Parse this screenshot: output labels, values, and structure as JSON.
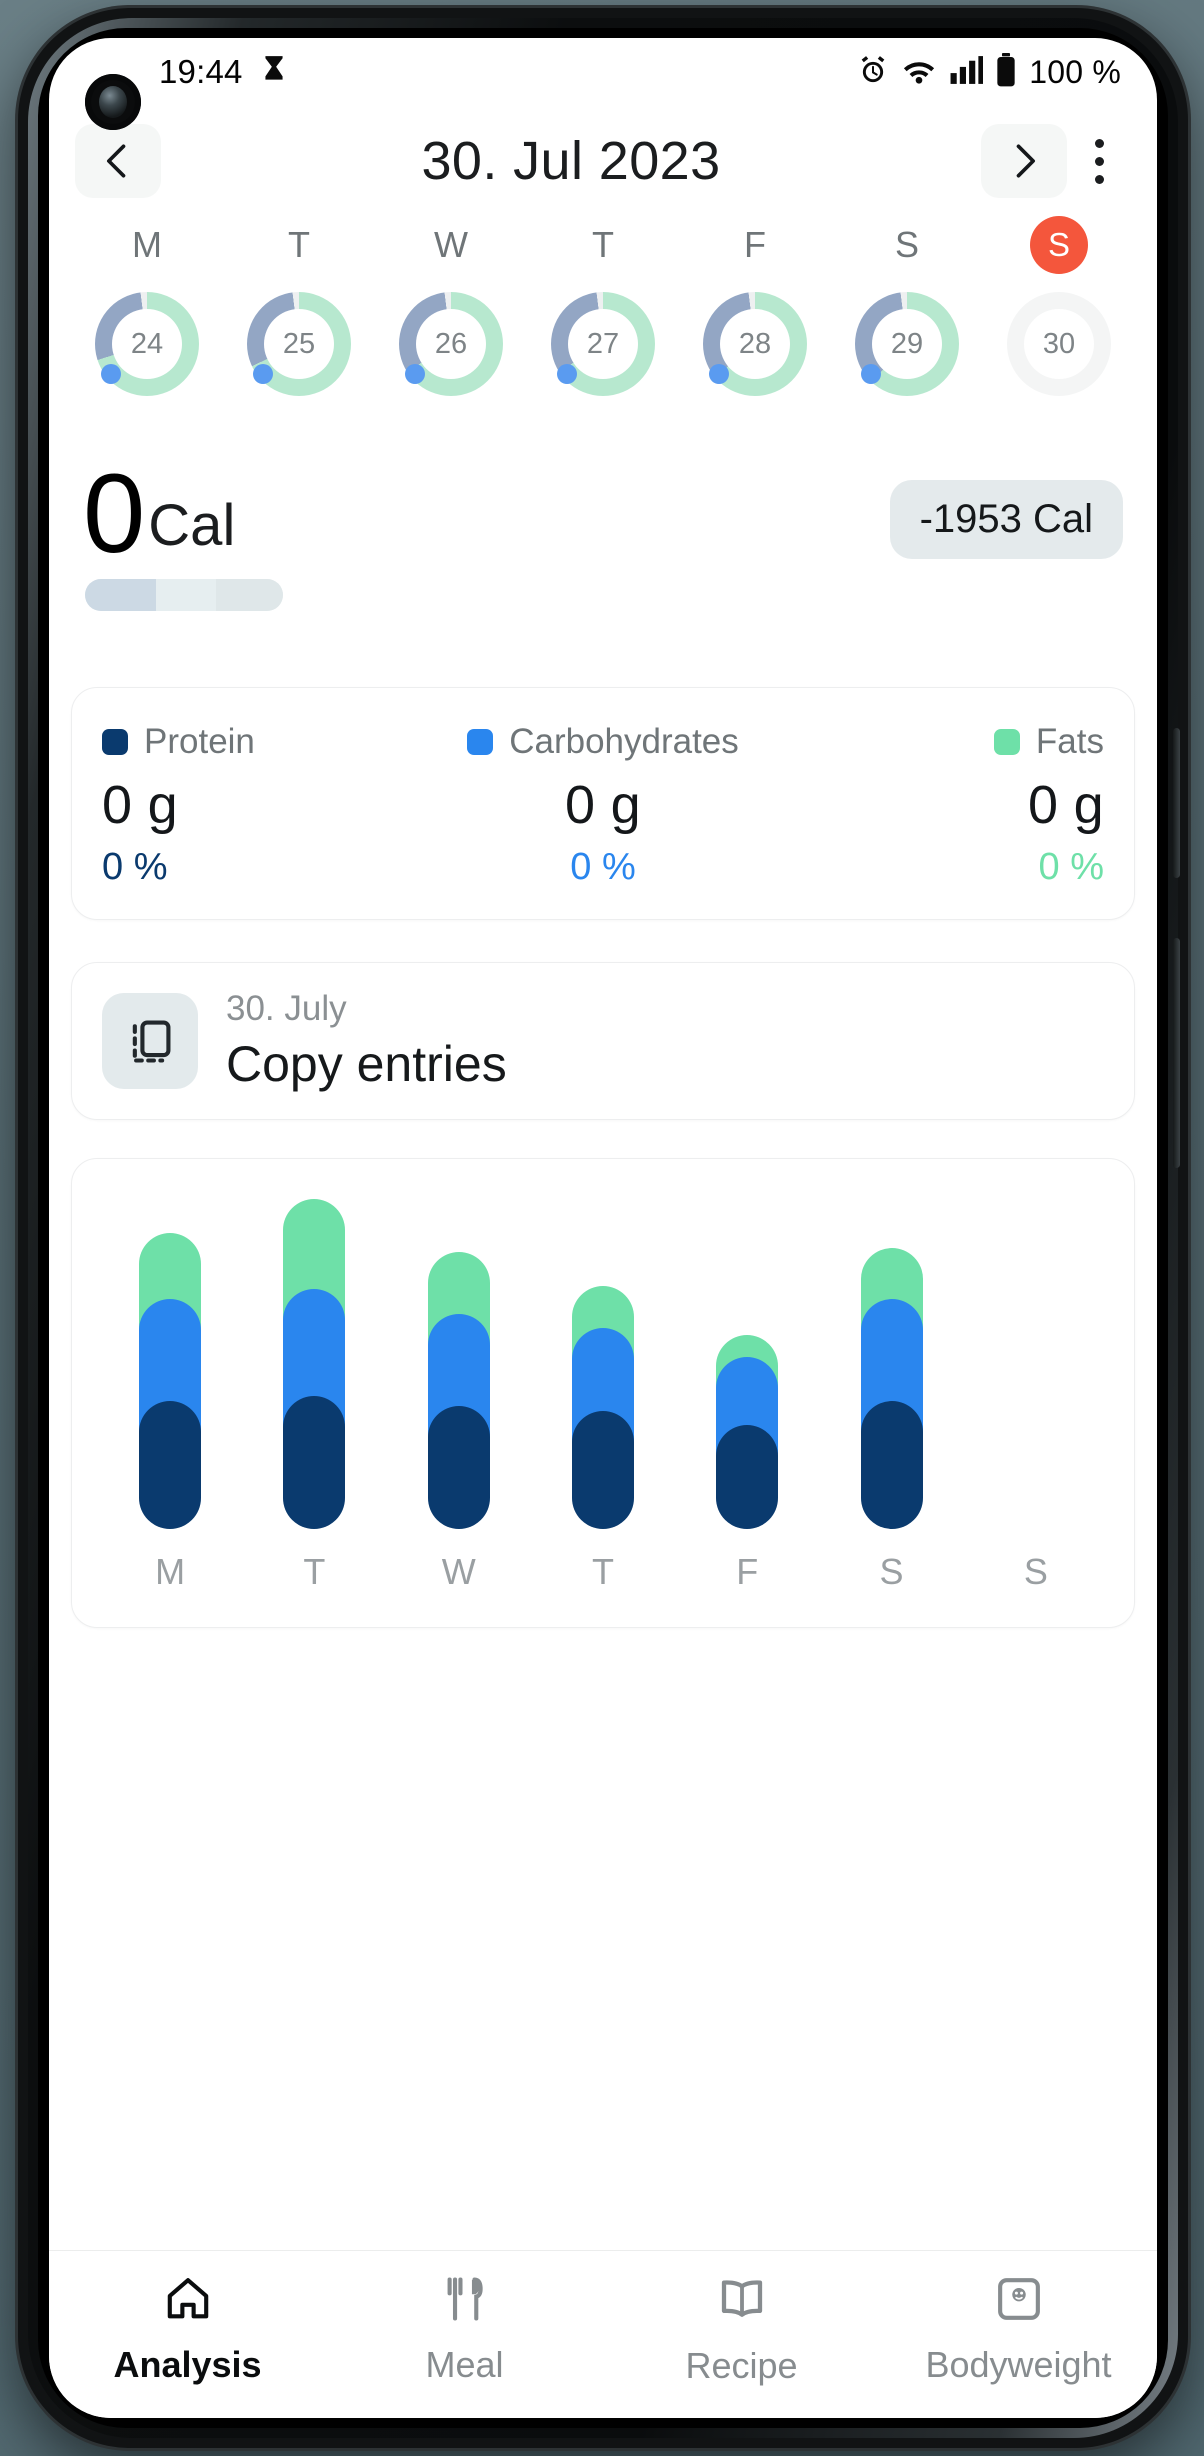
{
  "status_bar": {
    "time": "19:44",
    "battery_percent": "100 %",
    "icons": [
      "hourglass-icon",
      "alarm-icon",
      "wifi-icon",
      "signal-icon",
      "battery-icon"
    ]
  },
  "header": {
    "title": "30. Jul 2023",
    "prev_label": "chevron-left-icon",
    "next_label": "chevron-right-icon",
    "menu_label": "overflow-menu-icon"
  },
  "week_strip": {
    "days": [
      {
        "weekday": "M",
        "date": "24",
        "selected": false,
        "green": 70,
        "blue": 28,
        "dot": true
      },
      {
        "weekday": "T",
        "date": "25",
        "selected": false,
        "green": 68,
        "blue": 30,
        "dot": true
      },
      {
        "weekday": "W",
        "date": "26",
        "selected": false,
        "green": 66,
        "blue": 32,
        "dot": true
      },
      {
        "weekday": "T",
        "date": "27",
        "selected": false,
        "green": 66,
        "blue": 32,
        "dot": true
      },
      {
        "weekday": "F",
        "date": "28",
        "selected": false,
        "green": 64,
        "blue": 34,
        "dot": true
      },
      {
        "weekday": "S",
        "date": "29",
        "selected": false,
        "green": 62,
        "blue": 36,
        "dot": true
      },
      {
        "weekday": "S",
        "date": "30",
        "selected": true,
        "green": 0,
        "blue": 0,
        "dot": false
      }
    ]
  },
  "calories": {
    "value": "0",
    "unit": "Cal",
    "remaining_badge": "-1953 Cal"
  },
  "macros": {
    "items": [
      {
        "name": "Protein",
        "value": "0 g",
        "percent": "0 %",
        "color": "#0a3a6e"
      },
      {
        "name": "Carbohydrates",
        "value": "0 g",
        "percent": "0 %",
        "color": "#2a86ee"
      },
      {
        "name": "Fats",
        "value": "0 g",
        "percent": "0 %",
        "color": "#6ee0a8"
      }
    ]
  },
  "copy_entries": {
    "date": "30. July",
    "title": "Copy entries",
    "icon": "copy-icon"
  },
  "chart_data": {
    "type": "bar",
    "title": "",
    "xlabel": "",
    "ylabel": "",
    "stacked": true,
    "grid": false,
    "legend_position": "none",
    "categories": [
      "M",
      "T",
      "W",
      "T",
      "F",
      "S",
      "S"
    ],
    "series": [
      {
        "name": "Protein",
        "color": "#0a3a6e",
        "values": [
          100,
          105,
          95,
          90,
          75,
          100,
          0
        ]
      },
      {
        "name": "Carbohydrates",
        "color": "#2a86ee",
        "values": [
          105,
          110,
          95,
          85,
          70,
          105,
          0
        ]
      },
      {
        "name": "Fats",
        "color": "#6ee0a8",
        "values": [
          100,
          125,
          95,
          75,
          55,
          85,
          0
        ]
      }
    ],
    "ylim": [
      0,
      350
    ]
  },
  "bottom_nav": {
    "items": [
      {
        "label": "Analysis",
        "icon": "home-icon",
        "active": true
      },
      {
        "label": "Meal",
        "icon": "cutlery-icon",
        "active": false
      },
      {
        "label": "Recipe",
        "icon": "book-icon",
        "active": false
      },
      {
        "label": "Bodyweight",
        "icon": "scale-icon",
        "active": false
      }
    ]
  },
  "colors": {
    "accent_green": "#6ee0a8",
    "accent_blue": "#2a86ee",
    "accent_navy": "#0a3a6e",
    "today_badge": "#f4563c",
    "ring_green": "#b7e8cf",
    "ring_blue": "#93a6c4"
  }
}
